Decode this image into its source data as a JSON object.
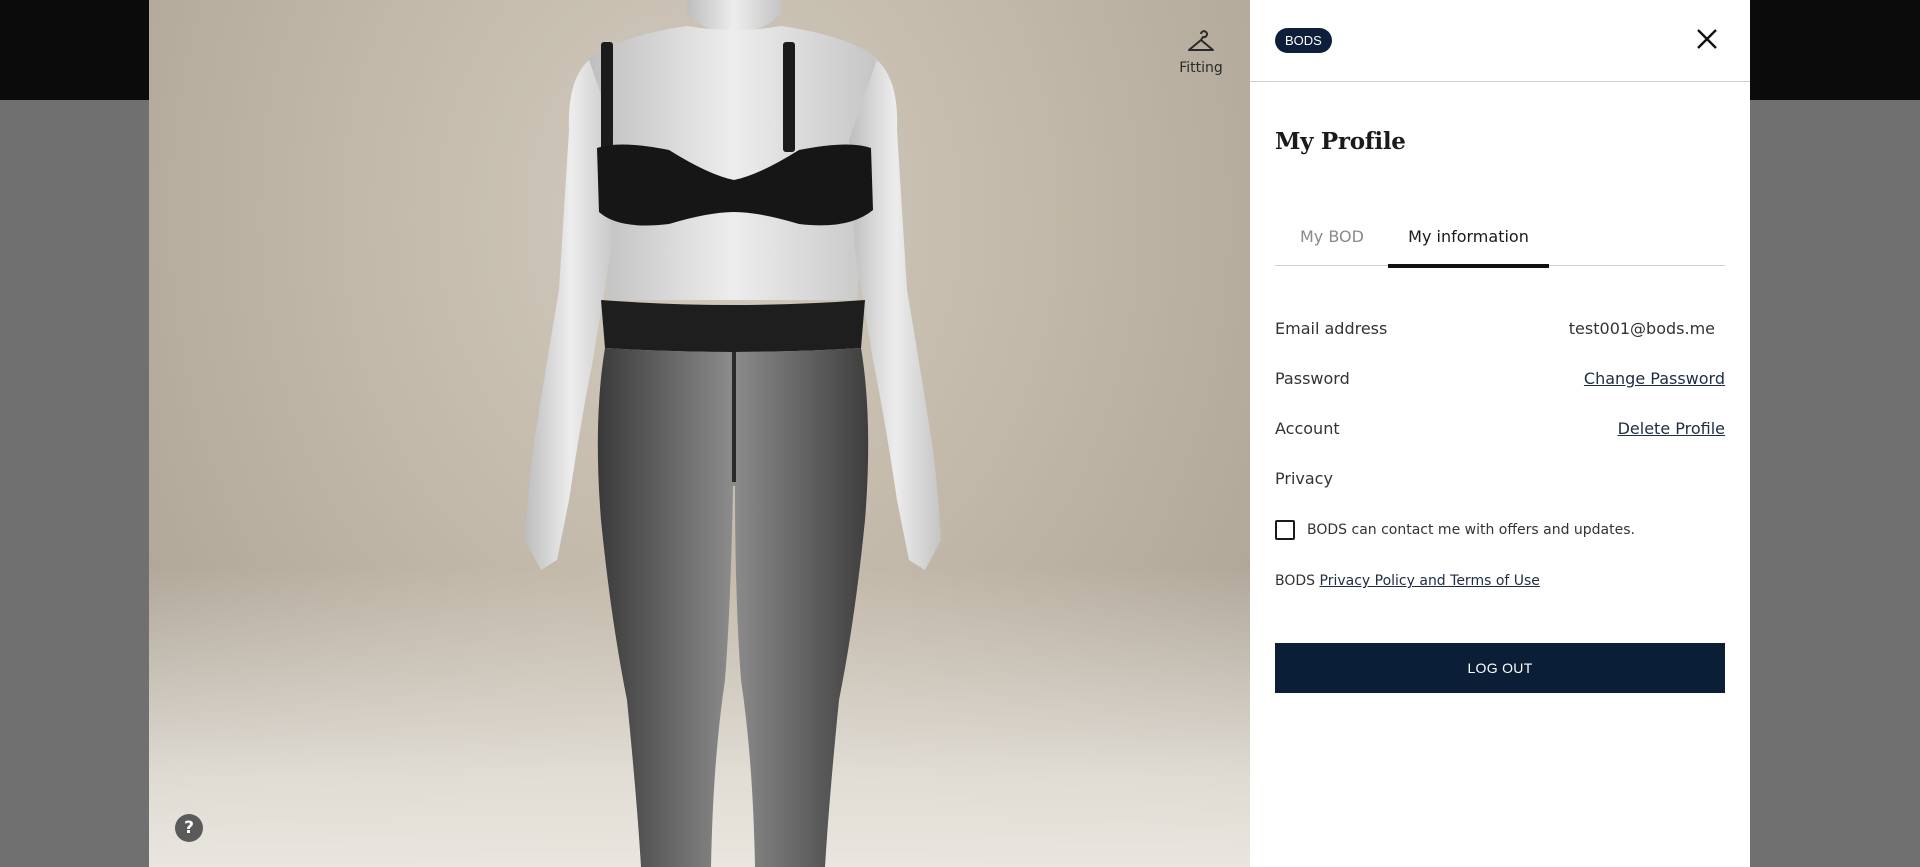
{
  "viewer": {
    "fitting_label": "Fitting",
    "help_glyph": "?",
    "icons": [
      "hanger-icon",
      "rotate-icon",
      "zoom-in-icon",
      "zoom-out-icon",
      "help-icon"
    ]
  },
  "panel": {
    "brand": "BODS",
    "title": "My Profile",
    "tabs": [
      {
        "label": "My BOD",
        "active": false
      },
      {
        "label": "My information",
        "active": true
      }
    ],
    "fields": {
      "email_label": "Email address",
      "email_value": "test001@bods.me",
      "password_label": "Password",
      "password_link": "Change Password",
      "account_label": "Account",
      "account_link": "Delete Profile",
      "privacy_label": "Privacy"
    },
    "consent": {
      "checked": false,
      "text": "BODS can contact me with offers and updates."
    },
    "privacy_prefix": "BODS",
    "privacy_link": "Privacy Policy and Terms of Use",
    "logout_label": "LOG OUT"
  },
  "colors": {
    "navy": "#0b1e38",
    "badge": "#0d1f3a",
    "topbar": "#0b0b0b",
    "backdrop": "#707070"
  }
}
